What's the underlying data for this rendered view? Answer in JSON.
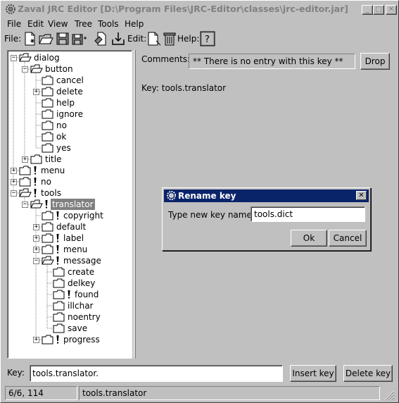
{
  "window": {
    "title": "Zaval JRC Editor [D:\\Program Files\\JRC-Editor\\classes\\jrc-editor.jar]",
    "minimize": "_",
    "maximize": "□",
    "close": "✕"
  },
  "menubar": [
    "File",
    "Edit",
    "View",
    "Tree",
    "Tools",
    "Help"
  ],
  "toolbar": {
    "file_label": "File:",
    "edit_label": "Edit:",
    "help_label": "Help:",
    "file_icons": [
      "new-file-icon",
      "open-folder-icon",
      "save-icon",
      "save-as-icon",
      "merge-icon",
      "import-icon"
    ],
    "edit_icons": [
      "new-key-icon",
      "delete-icon"
    ],
    "help_icons": [
      "help-icon"
    ]
  },
  "tree": {
    "items": [
      {
        "label": "dialog",
        "depth": 0,
        "expander": "−",
        "folder": "open",
        "excl": false,
        "selected": false
      },
      {
        "label": "button",
        "depth": 1,
        "expander": "−",
        "folder": "open",
        "excl": false,
        "selected": false
      },
      {
        "label": "cancel",
        "depth": 2,
        "expander": "",
        "folder": "closed",
        "excl": false,
        "selected": false
      },
      {
        "label": "delete",
        "depth": 2,
        "expander": "+",
        "folder": "closed",
        "excl": false,
        "selected": false
      },
      {
        "label": "help",
        "depth": 2,
        "expander": "",
        "folder": "closed",
        "excl": false,
        "selected": false
      },
      {
        "label": "ignore",
        "depth": 2,
        "expander": "",
        "folder": "closed",
        "excl": false,
        "selected": false
      },
      {
        "label": "no",
        "depth": 2,
        "expander": "",
        "folder": "closed",
        "excl": false,
        "selected": false
      },
      {
        "label": "ok",
        "depth": 2,
        "expander": "",
        "folder": "closed",
        "excl": false,
        "selected": false
      },
      {
        "label": "yes",
        "depth": 2,
        "expander": "",
        "folder": "closed",
        "excl": false,
        "selected": false
      },
      {
        "label": "title",
        "depth": 1,
        "expander": "+",
        "folder": "closed",
        "excl": false,
        "selected": false
      },
      {
        "label": "menu",
        "depth": 0,
        "expander": "+",
        "folder": "closed",
        "excl": true,
        "selected": false
      },
      {
        "label": "no",
        "depth": 0,
        "expander": "+",
        "folder": "closed",
        "excl": true,
        "selected": false
      },
      {
        "label": "tools",
        "depth": 0,
        "expander": "−",
        "folder": "open",
        "excl": true,
        "selected": false
      },
      {
        "label": "translator",
        "depth": 1,
        "expander": "−",
        "folder": "open",
        "excl": true,
        "selected": true
      },
      {
        "label": "copyright",
        "depth": 2,
        "expander": "",
        "folder": "closed",
        "excl": true,
        "selected": false
      },
      {
        "label": "default",
        "depth": 2,
        "expander": "+",
        "folder": "closed",
        "excl": false,
        "selected": false
      },
      {
        "label": "label",
        "depth": 2,
        "expander": "+",
        "folder": "closed",
        "excl": true,
        "selected": false
      },
      {
        "label": "menu",
        "depth": 2,
        "expander": "+",
        "folder": "closed",
        "excl": true,
        "selected": false
      },
      {
        "label": "message",
        "depth": 2,
        "expander": "−",
        "folder": "open",
        "excl": true,
        "selected": false
      },
      {
        "label": "create",
        "depth": 3,
        "expander": "",
        "folder": "closed",
        "excl": false,
        "selected": false
      },
      {
        "label": "delkey",
        "depth": 3,
        "expander": "",
        "folder": "closed",
        "excl": false,
        "selected": false
      },
      {
        "label": "found",
        "depth": 3,
        "expander": "",
        "folder": "closed",
        "excl": true,
        "selected": false
      },
      {
        "label": "illchar",
        "depth": 3,
        "expander": "",
        "folder": "closed",
        "excl": false,
        "selected": false
      },
      {
        "label": "noentry",
        "depth": 3,
        "expander": "",
        "folder": "closed",
        "excl": false,
        "selected": false
      },
      {
        "label": "save",
        "depth": 3,
        "expander": "",
        "folder": "closed",
        "excl": false,
        "selected": false
      },
      {
        "label": "progress",
        "depth": 2,
        "expander": "+",
        "folder": "closed",
        "excl": true,
        "selected": false
      }
    ]
  },
  "editor": {
    "comments_label": "Comments:",
    "comments_value": "** There is no entry with this key **",
    "drop_button": "Drop",
    "key_display": "Key: tools.translator"
  },
  "dialog": {
    "title": "Rename key",
    "close": "✕",
    "field_label": "Type new key name",
    "field_value": "tools.dict",
    "ok_button": "Ok",
    "cancel_button": "Cancel"
  },
  "bottom": {
    "key_label": "Key:",
    "key_value": "tools.translator.",
    "insert_button": "Insert key",
    "delete_button": "Delete key"
  },
  "status": {
    "counts": "6/6, 114",
    "current_key": "tools.translator"
  },
  "colors": {
    "face": "#c0c0c0",
    "dialog_title": "#0a246a",
    "selection": "#808080"
  }
}
